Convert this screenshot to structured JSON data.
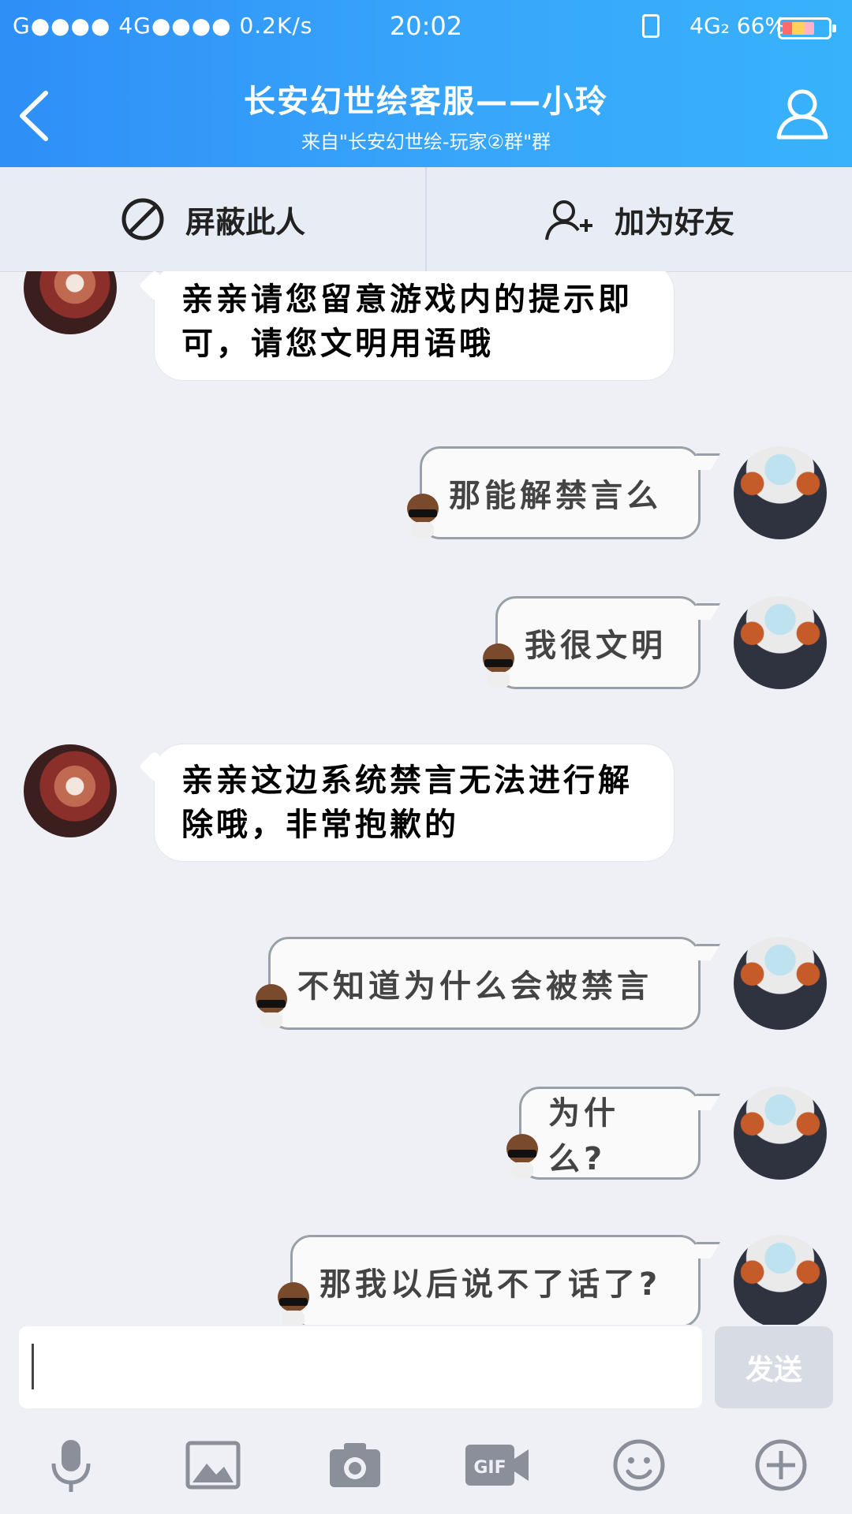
{
  "status_bar": {
    "left": "G●●●● 4G●●●● 0.2K/s",
    "time": "20:02",
    "right": "4G₂ 66%"
  },
  "header": {
    "title": "长安幻世绘客服——小玲",
    "subtitle": "来自\"长安幻世绘-玩家②群\"群"
  },
  "actions": {
    "block_label": "屏蔽此人",
    "add_friend_label": "加为好友"
  },
  "messages": [
    {
      "side": "in",
      "text": "亲亲请您留意游戏内的提示即可，请您文明用语哦"
    },
    {
      "side": "out",
      "text": "那能解禁言么"
    },
    {
      "side": "out",
      "text": "我很文明"
    },
    {
      "side": "in",
      "text": "亲亲这边系统禁言无法进行解除哦，非常抱歉的"
    },
    {
      "side": "out",
      "text": "不知道为什么会被禁言"
    },
    {
      "side": "out",
      "text": "为什么?"
    },
    {
      "side": "out",
      "text": "那我以后说不了话了?"
    }
  ],
  "input": {
    "placeholder": "",
    "send_label": "发送"
  },
  "toolbar_icons": [
    "microphone-icon",
    "image-icon",
    "camera-icon",
    "gif-icon",
    "emoji-icon",
    "plus-icon"
  ]
}
